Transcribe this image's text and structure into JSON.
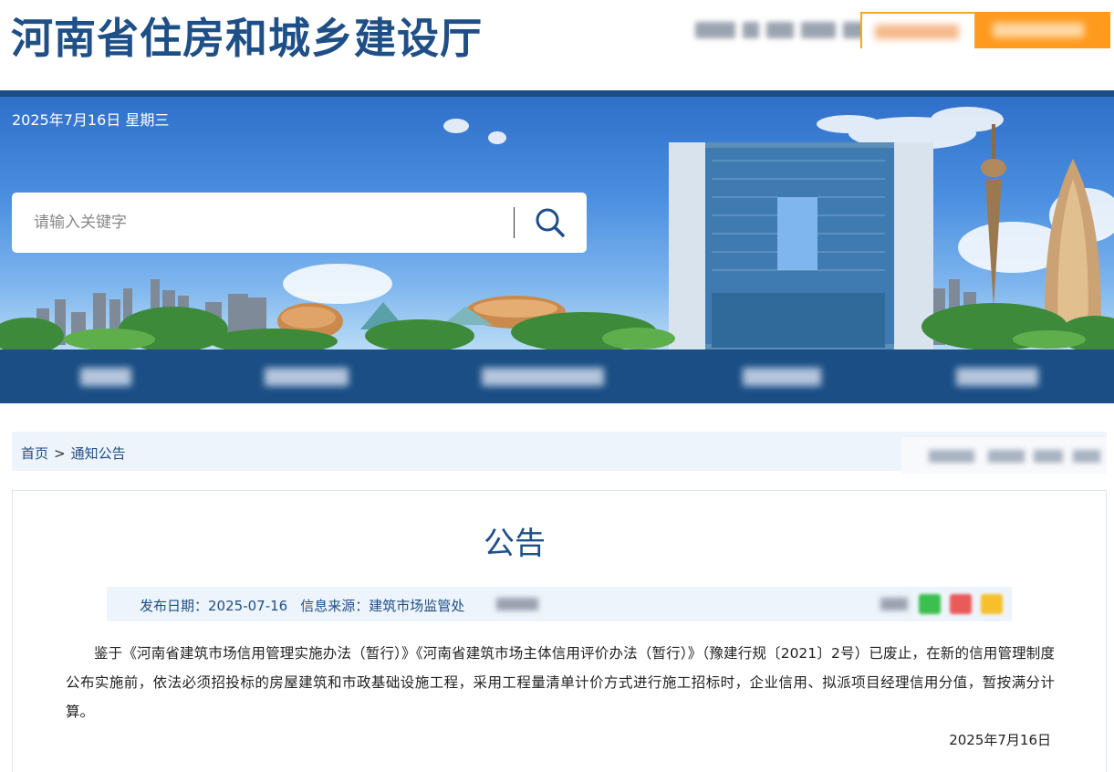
{
  "header": {
    "site_title": "河南省住房和城乡建设厅"
  },
  "banner": {
    "date_text": "2025年7月16日 星期三",
    "search_placeholder": "请输入关键字"
  },
  "breadcrumb": {
    "home": "首页",
    "separator": ">",
    "current": "通知公告"
  },
  "article": {
    "title": "公告",
    "publish_label": "发布日期：",
    "publish_date": "2025-07-16",
    "source_label": "信息来源：",
    "source": "建筑市场监管处",
    "body": "鉴于《河南省建筑市场信用管理实施办法（暂行）》《河南省建筑市场主体信用评价办法（暂行）》（豫建行规〔2021〕2号）已废止，在新的信用管理制度公布实施前，依法必须招投标的房屋建筑和市政基础设施工程，采用工程量清单计价方式进行施工招标时，企业信用、拟派项目经理信用分值，暂按满分计算。",
    "sign_date": "2025年7月16日"
  },
  "colors": {
    "brand_blue": "#1a4e84",
    "title_blue": "#1e4f86",
    "orange": "#ff9a1f",
    "share_green": "#3cbf4e",
    "share_red": "#e95b5b",
    "share_yellow": "#f5c02a"
  },
  "icons": {
    "search": "magnifier-icon"
  }
}
